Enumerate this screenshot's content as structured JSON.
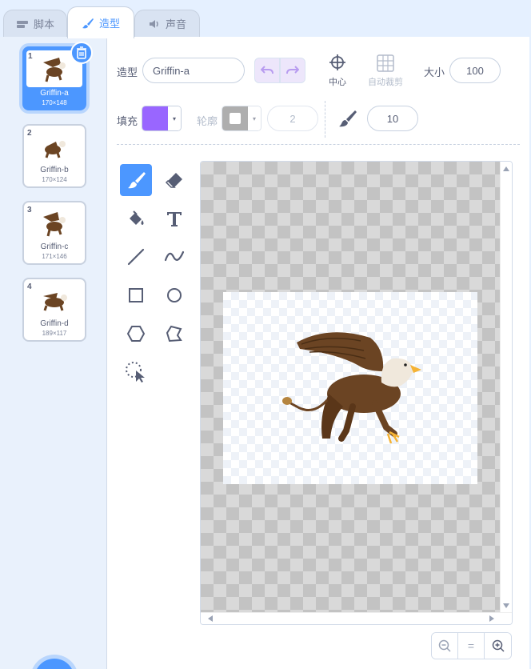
{
  "tabs": [
    {
      "label": "脚本",
      "icon": "code-icon"
    },
    {
      "label": "造型",
      "icon": "brush-icon"
    },
    {
      "label": "声音",
      "icon": "speaker-icon"
    }
  ],
  "costumes": [
    {
      "index": "1",
      "name": "Griffin-a",
      "size": "170×148"
    },
    {
      "index": "2",
      "name": "Griffin-b",
      "size": "170×124"
    },
    {
      "index": "3",
      "name": "Griffin-c",
      "size": "171×146"
    },
    {
      "index": "4",
      "name": "Griffin-d",
      "size": "189×117"
    }
  ],
  "selected_costume": "Griffin-a",
  "toolbar": {
    "costume_label": "造型",
    "costume_name": "Griffin-a",
    "center_label": "中心",
    "auto_crop_label": "自动裁剪",
    "size_label": "大小",
    "size_value": "100",
    "fill_label": "填充",
    "fill_color": "#9966ff",
    "outline_label": "轮廓",
    "outline_width": "2",
    "brush_size": "10"
  },
  "tools": [
    "brush",
    "eraser",
    "fill",
    "text",
    "line",
    "curve",
    "rectangle",
    "circle",
    "reshape-polygon",
    "reshape",
    "select"
  ],
  "active_tool": "brush",
  "zoom": {
    "out": "−",
    "reset": "=",
    "in": "+"
  },
  "colors": {
    "accent": "#4c97ff",
    "griffin_body": "#6b4423",
    "griffin_head": "#f0e8dc",
    "beak": "#f5b335"
  }
}
